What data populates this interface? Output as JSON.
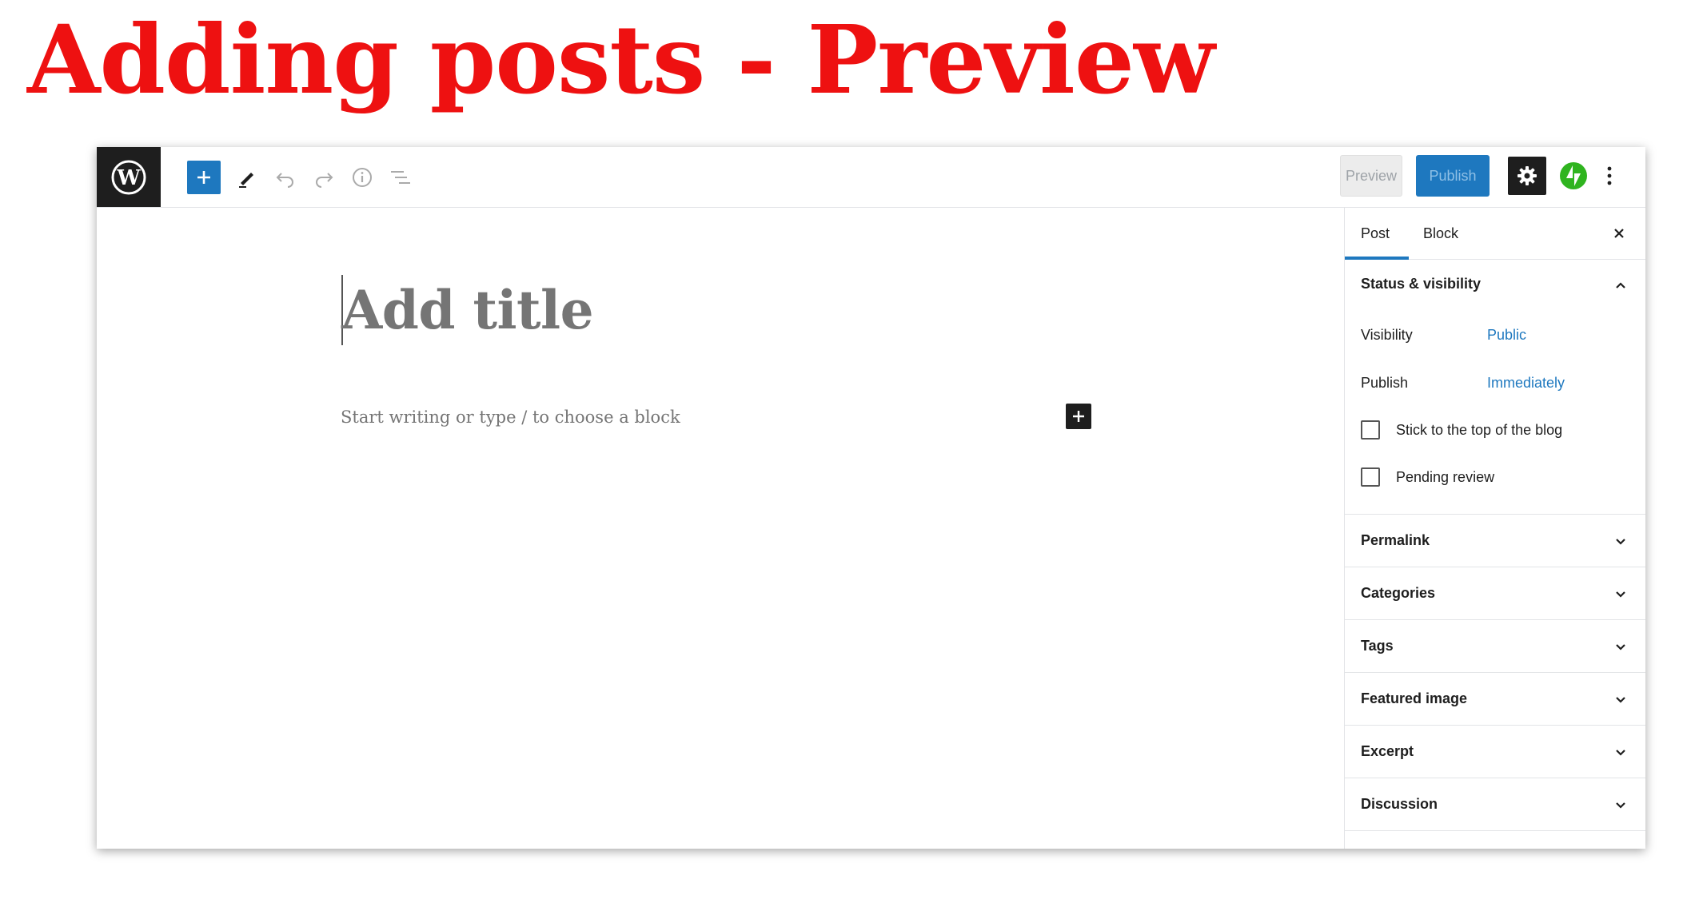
{
  "slide": {
    "title": "Adding posts - Preview"
  },
  "toolbar": {
    "wordpress_logo": "wordpress-logo",
    "add_block": "plus-icon",
    "tools": "pencil-icon",
    "undo": "undo-icon",
    "redo": "redo-icon",
    "details": "info-icon",
    "outline": "list-view-icon",
    "preview_label": "Preview",
    "publish_label": "Publish",
    "settings": "gear-icon",
    "jetpack": "jetpack-icon",
    "more": "more-vertical-icon",
    "accent_color": "#1e78bf",
    "jetpack_color": "#2fb41f"
  },
  "editor": {
    "title_placeholder": "Add title",
    "block_placeholder": "Start writing or type / to choose a block"
  },
  "sidebar": {
    "tabs": [
      {
        "label": "Post",
        "active": true
      },
      {
        "label": "Block",
        "active": false
      }
    ],
    "status_panel": {
      "title": "Status & visibility",
      "expanded": true,
      "visibility_label": "Visibility",
      "visibility_value": "Public",
      "publish_label": "Publish",
      "publish_value": "Immediately",
      "checkboxes": [
        {
          "label": "Stick to the top of the blog",
          "checked": false
        },
        {
          "label": "Pending review",
          "checked": false
        }
      ]
    },
    "panels": [
      {
        "title": "Permalink"
      },
      {
        "title": "Categories"
      },
      {
        "title": "Tags"
      },
      {
        "title": "Featured image"
      },
      {
        "title": "Excerpt"
      },
      {
        "title": "Discussion"
      }
    ]
  }
}
